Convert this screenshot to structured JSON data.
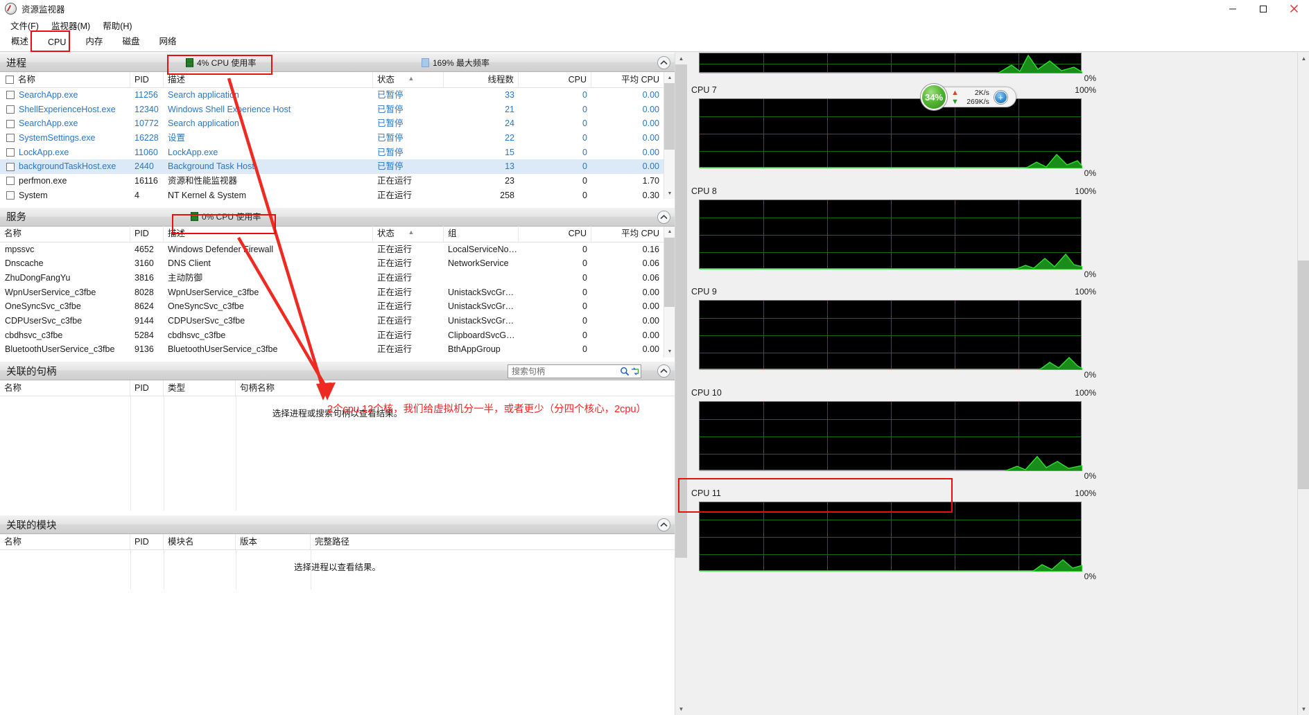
{
  "window": {
    "title": "资源监视器",
    "icon": "resource-monitor-icon",
    "buttons": {
      "minimize": "—",
      "maximize": "❐",
      "close": "✕"
    }
  },
  "menu": {
    "items": [
      "文件(F)",
      "监视器(M)",
      "帮助(H)"
    ]
  },
  "tabs": {
    "items": [
      "概述",
      "CPU",
      "内存",
      "磁盘",
      "网络"
    ],
    "active": "CPU"
  },
  "processes": {
    "title": "进程",
    "cpu_usage": "4% CPU 使用率",
    "max_frequency": "169% 最大频率",
    "columns": [
      "名称",
      "PID",
      "描述",
      "状态",
      "线程数",
      "CPU",
      "平均 CPU"
    ],
    "rows": [
      {
        "name": "SearchApp.exe",
        "pid": "11256",
        "desc": "Search application",
        "status": "已暂停",
        "threads": "33",
        "cpu": "0",
        "avg": "0.00",
        "dim": true,
        "sel": false
      },
      {
        "name": "ShellExperienceHost.exe",
        "pid": "12340",
        "desc": "Windows Shell Experience Host",
        "status": "已暂停",
        "threads": "21",
        "cpu": "0",
        "avg": "0.00",
        "dim": true,
        "sel": false
      },
      {
        "name": "SearchApp.exe",
        "pid": "10772",
        "desc": "Search application",
        "status": "已暂停",
        "threads": "24",
        "cpu": "0",
        "avg": "0.00",
        "dim": true,
        "sel": false
      },
      {
        "name": "SystemSettings.exe",
        "pid": "16228",
        "desc": "设置",
        "status": "已暂停",
        "threads": "22",
        "cpu": "0",
        "avg": "0.00",
        "dim": true,
        "sel": false
      },
      {
        "name": "LockApp.exe",
        "pid": "11060",
        "desc": "LockApp.exe",
        "status": "已暂停",
        "threads": "15",
        "cpu": "0",
        "avg": "0.00",
        "dim": true,
        "sel": false
      },
      {
        "name": "backgroundTaskHost.exe",
        "pid": "2440",
        "desc": "Background Task Host",
        "status": "已暂停",
        "threads": "13",
        "cpu": "0",
        "avg": "0.00",
        "dim": true,
        "sel": true
      },
      {
        "name": "perfmon.exe",
        "pid": "16116",
        "desc": "资源和性能监视器",
        "status": "正在运行",
        "threads": "23",
        "cpu": "0",
        "avg": "1.70",
        "dim": false,
        "sel": false
      },
      {
        "name": "System",
        "pid": "4",
        "desc": "NT Kernel & System",
        "status": "正在运行",
        "threads": "258",
        "cpu": "0",
        "avg": "0.30",
        "dim": false,
        "sel": false
      }
    ]
  },
  "services": {
    "title": "服务",
    "cpu_usage": "0% CPU 使用率",
    "columns": [
      "名称",
      "PID",
      "描述",
      "状态",
      "组",
      "CPU",
      "平均 CPU"
    ],
    "rows": [
      {
        "name": "mpssvc",
        "pid": "4652",
        "desc": "Windows Defender Firewall",
        "status": "正在运行",
        "group": "LocalServiceNo…",
        "cpu": "0",
        "avg": "0.16"
      },
      {
        "name": "Dnscache",
        "pid": "3160",
        "desc": "DNS Client",
        "status": "正在运行",
        "group": "NetworkService",
        "cpu": "0",
        "avg": "0.06"
      },
      {
        "name": "ZhuDongFangYu",
        "pid": "3816",
        "desc": "主动防御",
        "status": "正在运行",
        "group": "",
        "cpu": "0",
        "avg": "0.06"
      },
      {
        "name": "WpnUserService_c3fbe",
        "pid": "8028",
        "desc": "WpnUserService_c3fbe",
        "status": "正在运行",
        "group": "UnistackSvcGr…",
        "cpu": "0",
        "avg": "0.00"
      },
      {
        "name": "OneSyncSvc_c3fbe",
        "pid": "8624",
        "desc": "OneSyncSvc_c3fbe",
        "status": "正在运行",
        "group": "UnistackSvcGr…",
        "cpu": "0",
        "avg": "0.00"
      },
      {
        "name": "CDPUserSvc_c3fbe",
        "pid": "9144",
        "desc": "CDPUserSvc_c3fbe",
        "status": "正在运行",
        "group": "UnistackSvcGr…",
        "cpu": "0",
        "avg": "0.00"
      },
      {
        "name": "cbdhsvc_c3fbe",
        "pid": "5284",
        "desc": "cbdhsvc_c3fbe",
        "status": "正在运行",
        "group": "ClipboardSvcG…",
        "cpu": "0",
        "avg": "0.00"
      },
      {
        "name": "BluetoothUserService_c3fbe",
        "pid": "9136",
        "desc": "BluetoothUserService_c3fbe",
        "status": "正在运行",
        "group": "BthAppGroup",
        "cpu": "0",
        "avg": "0.00"
      }
    ]
  },
  "handles": {
    "title": "关联的句柄",
    "search_placeholder": "搜索句柄",
    "columns": [
      "名称",
      "PID",
      "类型",
      "句柄名称"
    ],
    "empty_message": "选择进程或搜索句柄以查看结果。"
  },
  "modules": {
    "title": "关联的模块",
    "columns": [
      "名称",
      "PID",
      "模块名",
      "版本",
      "完整路径"
    ],
    "empty_message": "选择进程以查看结果。"
  },
  "annotation": {
    "text": "2个cpu,12个核，我们给虚拟机分一半，或者更少（分四个核心，2cpu）",
    "color": "#ff2020"
  },
  "tooltip": {
    "percent": "34%",
    "up_value": "2K/s",
    "down_value": "269K/s",
    "up_icon": "arrow-up-icon",
    "down_icon": "arrow-down-icon",
    "plus_icon": "plus-icon"
  },
  "graphs": {
    "max_label": "100%",
    "min_label": "0%",
    "items": [
      {
        "label": "",
        "partial_top": true
      },
      {
        "label": "CPU 7"
      },
      {
        "label": "CPU 8"
      },
      {
        "label": "CPU 9"
      },
      {
        "label": "CPU 10"
      },
      {
        "label": "CPU 11"
      }
    ]
  },
  "colors": {
    "accent_red": "#e8100f",
    "link_blue": "#2a76c6",
    "graph_green": "#21c521",
    "selection": "#dce9f7"
  }
}
